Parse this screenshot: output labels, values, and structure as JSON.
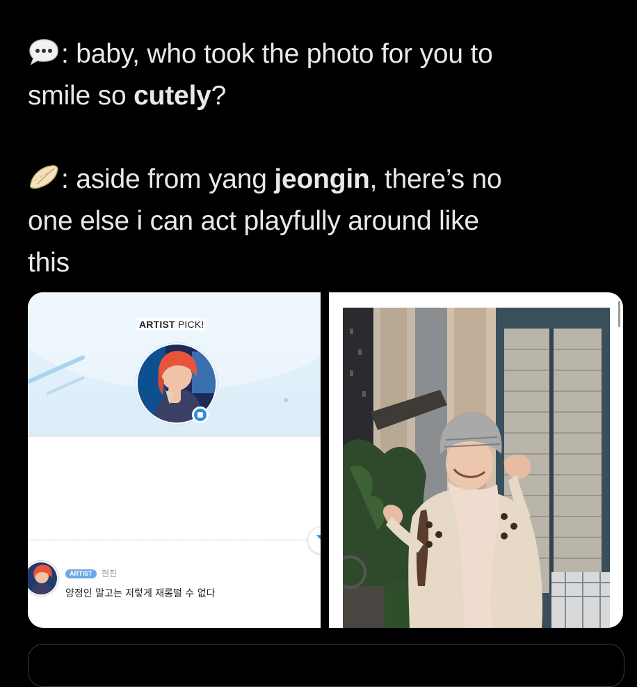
{
  "tweet": {
    "line1": {
      "emoji": "speech-bubble-icon",
      "pre": ": baby, who took the photo for you to",
      "line2_pre": "smile so ",
      "line2_bold": "cutely",
      "line2_post": "?"
    },
    "line2": {
      "emoji": "dumpling-icon",
      "pre": ": aside from yang ",
      "bold": "jeongin",
      "post": ", there’s no",
      "line2": "one else i can act playfully around like",
      "line3": "this"
    }
  },
  "media": {
    "left": {
      "artist_pick_bold": "ARTIST",
      "artist_pick_rest": " PICK!",
      "comment_badge": "ARTIST",
      "comment_name": "현진",
      "comment_text": "양정인 말고는 저렇게 재롱떨 수 없다"
    },
    "right": {
      "description_icon": "photo"
    }
  },
  "colors": {
    "background": "#000000",
    "text": "#e7e9ea",
    "accent_blue": "#2b8fd9",
    "band_blue": "#e6f3fb"
  }
}
